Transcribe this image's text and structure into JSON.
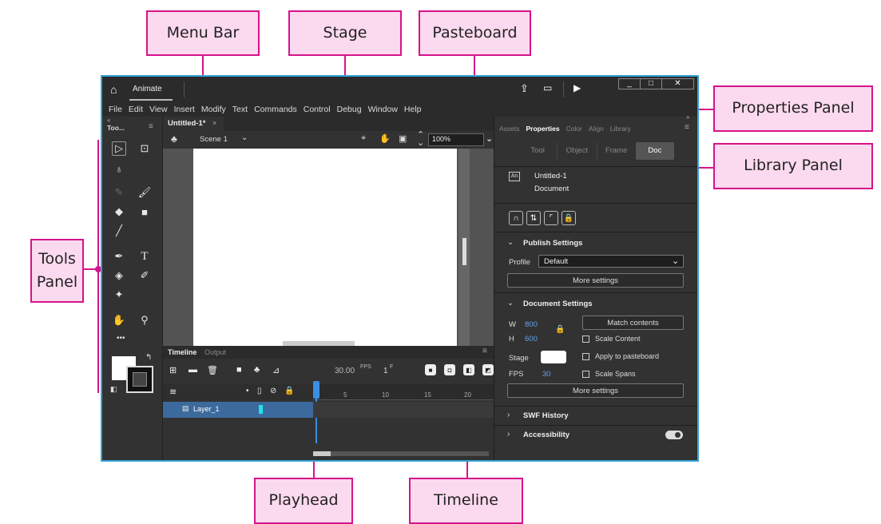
{
  "callouts": {
    "menu_bar": "Menu Bar",
    "stage": "Stage",
    "pasteboard": "Pasteboard",
    "properties_panel": "Properties Panel",
    "library_panel": "Library Panel",
    "tools_panel": "Tools Panel",
    "playhead": "Playhead",
    "timeline": "Timeline"
  },
  "colors": {
    "callout_bg": "#fbd9ee",
    "callout_border": "#d6138b",
    "app_frame": "#35a3d6",
    "accent": "#5ea2f0"
  },
  "titlebar": {
    "app_tab": "Animate"
  },
  "menu": [
    "File",
    "Edit",
    "View",
    "Insert",
    "Modify",
    "Text",
    "Commands",
    "Control",
    "Debug",
    "Window",
    "Help"
  ],
  "tools_panel": {
    "title": "Too...",
    "more": "•••"
  },
  "document": {
    "tab": "Untitled-1*",
    "scene": "Scene 1",
    "zoom": "100%"
  },
  "timeline_panel": {
    "tabs": [
      "Timeline",
      "Output"
    ],
    "fps": "30.00",
    "fps_unit": "FPS",
    "frame": "1",
    "frame_unit": "F",
    "frame_numbers": [
      "5",
      "10",
      "15",
      "20"
    ],
    "layer_name": "Layer_1"
  },
  "properties": {
    "tabs": [
      "Assets",
      "Properties",
      "Color",
      "Align",
      "Library"
    ],
    "subtabs": [
      "Tool",
      "Object",
      "Frame",
      "Doc"
    ],
    "doc_name": "Untitled-1",
    "doc_type": "Document",
    "publish": {
      "header": "Publish Settings",
      "profile_label": "Profile",
      "profile_value": "Default",
      "more": "More settings"
    },
    "docsettings": {
      "header": "Document Settings",
      "w_label": "W",
      "w_value": "800",
      "h_label": "H",
      "h_value": "600",
      "match": "Match contents",
      "scale_content": "Scale Content",
      "stage_label": "Stage",
      "apply_paste": "Apply to pasteboard",
      "fps_label": "FPS",
      "fps_value": "30",
      "scale_spans": "Scale Spans",
      "more": "More settings"
    },
    "swf_history": "SWF History",
    "accessibility": "Accessibility"
  }
}
